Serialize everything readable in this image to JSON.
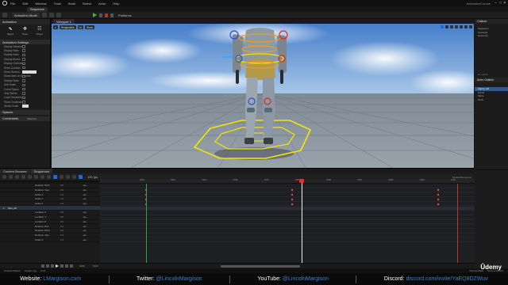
{
  "menubar": {
    "items": [
      "File",
      "Edit",
      "Window",
      "Tools",
      "Build",
      "Select",
      "Actor",
      "Help"
    ],
    "project": "AnimationCourse",
    "win_min": "–",
    "win_max": "□",
    "win_close": "✕"
  },
  "tab": {
    "label": "Sequence"
  },
  "toolbar": {
    "mode": "Animation Mode",
    "platforms": "Platforms"
  },
  "left_panel": {
    "tab": "Animation",
    "buttons": [
      {
        "label": "Select",
        "icon": "⬉"
      },
      {
        "label": "Pose",
        "icon": "✥"
      },
      {
        "label": "Poses",
        "icon": "☷"
      }
    ],
    "section": "Animation Settings",
    "options": [
      "Display Hierarchy",
      "Display Nulls",
      "Display Nulls",
      "Display Bones",
      "Display Controls",
      "Show Controls",
      "Show Gizmos",
      "Show Axes on Selection",
      "Display Stats",
      "Axis Scale",
      "Coord Space",
      "Only Select",
      "Local Transform",
      "Show Cooldown",
      "Gizmo Scale"
    ],
    "spaces": "Spaces",
    "constraints": "Constraints",
    "constraints_value": "Selected"
  },
  "viewport": {
    "tab": "Viewport 1",
    "perspective": "Perspective",
    "lit": "Lit",
    "show": "Show"
  },
  "right_panel": {
    "outliner_tab": "Outliner",
    "outliner_items": [
      "Sequence",
      "Cameras",
      "Geometry"
    ],
    "details_tab": "Anim Outliner",
    "outliner_rows": [
      "Items",
      "Pelvis",
      "Spine",
      "Neck"
    ],
    "selected_row": "Figure_ctrl",
    "actors_label": "12 actors"
  },
  "sequencer": {
    "tabs": [
      "Content Browser",
      "Sequencer"
    ],
    "fps": "120 fps",
    "title": "SkeletalSequence",
    "tracks": [
      {
        "name": "Rotation Pitch",
        "value": "0.0",
        "bone": false
      },
      {
        "name": "Rotation Yaw",
        "value": "0.0",
        "bone": false
      },
      {
        "name": "Scale X",
        "value": "1.0",
        "bone": false
      },
      {
        "name": "Scale Y",
        "value": "1.0",
        "bone": false
      },
      {
        "name": "Scale Z",
        "value": "1.0",
        "bone": false
      },
      {
        "name": "hips_ctrl",
        "value": "",
        "bone": true
      },
      {
        "name": "Location X",
        "value": "0.0",
        "bone": false
      },
      {
        "name": "Location Y",
        "value": "0.0",
        "bone": false
      },
      {
        "name": "Location Z",
        "value": "0.0",
        "bone": false
      },
      {
        "name": "Rotation Roll",
        "value": "0.0",
        "bone": false
      },
      {
        "name": "Rotation Pitch",
        "value": "0.0",
        "bone": false
      },
      {
        "name": "Rotation Yaw",
        "value": "0.0",
        "bone": false
      },
      {
        "name": "Scale X",
        "value": "1.0",
        "bone": false
      }
    ],
    "ruler_labels": [
      "0000",
      "0010",
      "0020",
      "0030",
      "0040",
      "0050",
      "0060",
      "0070",
      "0080",
      "0090",
      "0100",
      "0110",
      "0120",
      "0130",
      "0140",
      "0150"
    ],
    "playhead_label": "0050",
    "range_start": "0000",
    "range_end": "0100",
    "key_frames": [
      0,
      47,
      94
    ]
  },
  "statusbar": {
    "items": [
      "Content Drawer",
      "Output Log",
      "Cmd"
    ],
    "right": [
      "Derived Data",
      "Source Control"
    ]
  },
  "banner": {
    "website_label": "Website:",
    "website": "LMargison.com",
    "twitter_label": "Twitter:",
    "twitter": "@LincolnMargison",
    "youtube_label": "YouTube:",
    "youtube": "@LincolnMargison",
    "discord_label": "Discord:",
    "discord": "discord.com/invite/YaEQ8DZWuv"
  },
  "watermark": "Ûdemy",
  "colors": {
    "accent": "#1a6bd6",
    "keyframe": "#e85a4a",
    "playhead": "#e03030",
    "link": "#3d7fd4",
    "gizmo_yellow": "#f2e600"
  }
}
